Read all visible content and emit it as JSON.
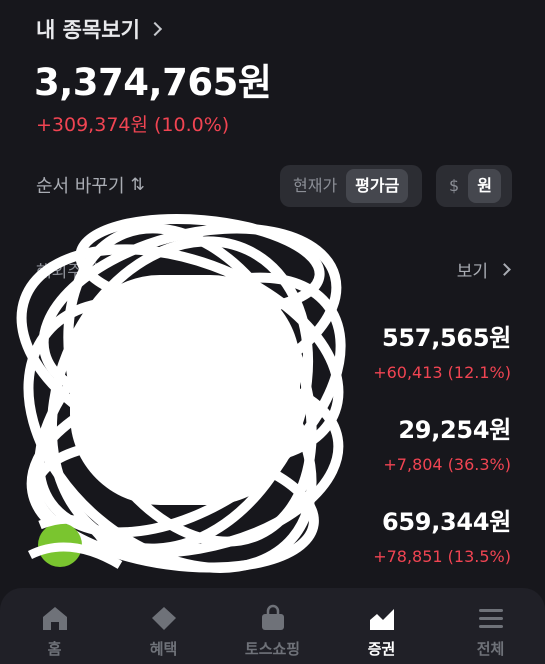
{
  "header": {
    "title": "내 종목보기"
  },
  "summary": {
    "total": "3,374,765원",
    "change": "+309,374원 (10.0%)"
  },
  "controls": {
    "sort_label": "순서 바꾸기",
    "sort_icon": "⇅",
    "price_options": [
      "현재가",
      "평가금"
    ],
    "price_selected": "평가금",
    "currency_options": [
      "$",
      "원"
    ],
    "currency_selected": "원"
  },
  "section": {
    "label": "해외주식",
    "view_label": "보기"
  },
  "holdings": [
    {
      "value": "557,565원",
      "change": "+60,413 (12.1%)"
    },
    {
      "value": "29,254원",
      "change": "+7,804 (36.3%)"
    },
    {
      "value": "659,344원",
      "change": "+78,851 (13.5%)"
    }
  ],
  "tabs": [
    {
      "label": "홈",
      "icon": "home-icon"
    },
    {
      "label": "혜택",
      "icon": "diamond-icon"
    },
    {
      "label": "토스쇼핑",
      "icon": "shopping-bag-icon"
    },
    {
      "label": "증권",
      "icon": "chart-icon"
    },
    {
      "label": "전체",
      "icon": "menu-icon"
    }
  ],
  "active_tab": "증권",
  "colors": {
    "background": "#17171c",
    "up": "#f04452",
    "tabbar": "#202027"
  }
}
